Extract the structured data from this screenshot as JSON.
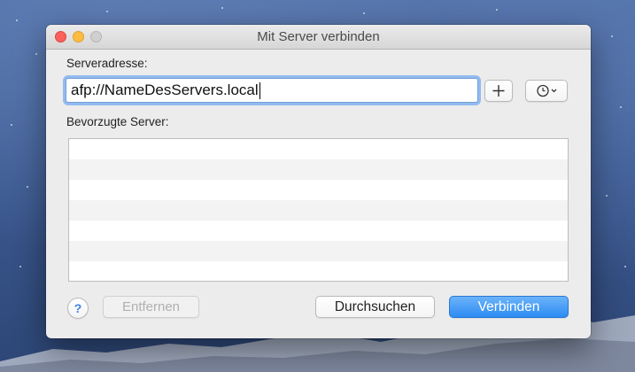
{
  "window": {
    "title": "Mit Server verbinden"
  },
  "form": {
    "address_label": "Serveradresse:",
    "address_value": "afp://NameDesServers.local",
    "favorites_label": "Bevorzugte Server:",
    "favorites_rows": 7
  },
  "buttons": {
    "add_icon": "plus-icon",
    "history_icon": "clock-icon",
    "help_label": "?",
    "remove_label": "Entfernen",
    "browse_label": "Durchsuchen",
    "connect_label": "Verbinden"
  },
  "colors": {
    "accent": "#2d8cf2",
    "focus_ring": "#93bbef",
    "close": "#fc605c",
    "minimize": "#fdbc40",
    "zoom_disabled": "#cfcfcf"
  }
}
